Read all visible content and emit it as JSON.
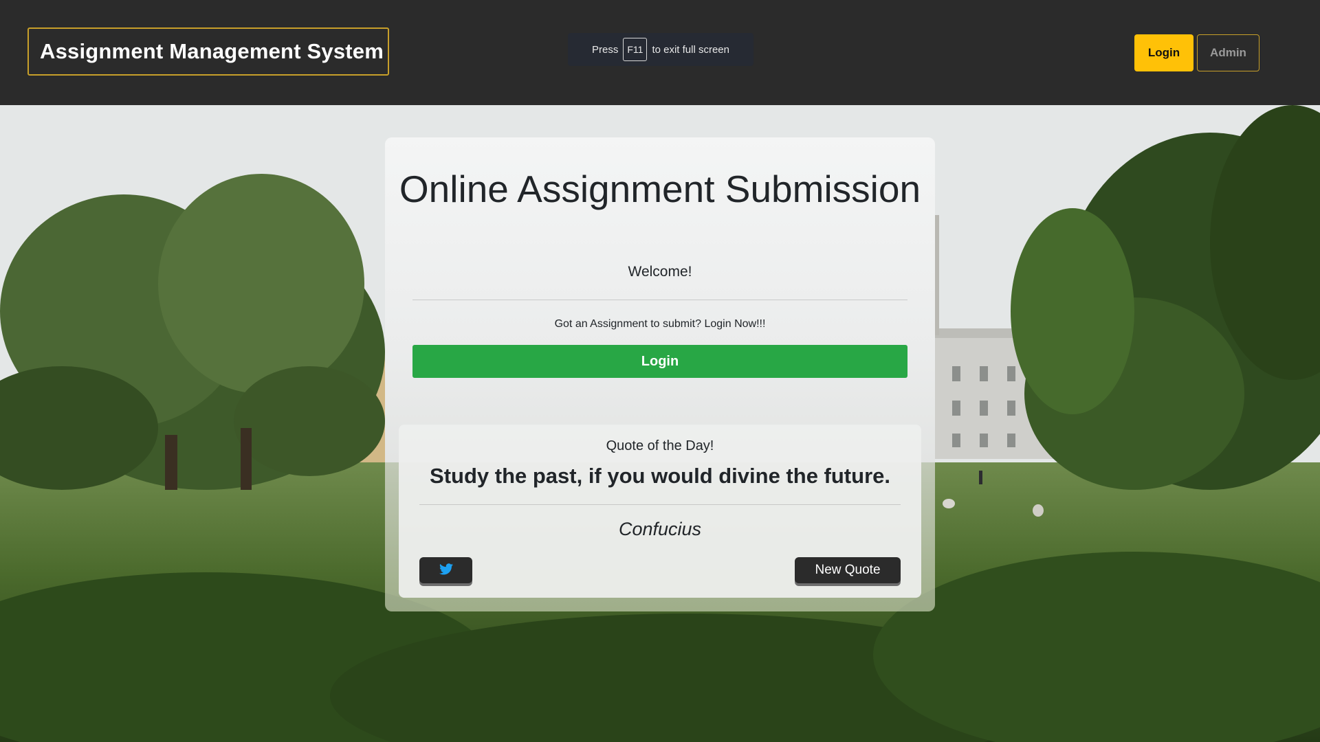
{
  "header": {
    "brand_title": "Assignment Management System",
    "login_label": "Login",
    "admin_label": "Admin"
  },
  "fullscreen_notice": {
    "press": "Press",
    "key": "F11",
    "suffix": "to exit full screen"
  },
  "main": {
    "title": "Online Assignment Submission",
    "welcome": "Welcome!",
    "prompt": "Got an Assignment to submit? Login Now!!!",
    "login_label": "Login"
  },
  "quote": {
    "heading": "Quote of the Day!",
    "text": "Study the past, if you would divine the future.",
    "author": "Confucius",
    "tweet_icon": "twitter-icon",
    "new_quote_label": "New Quote"
  },
  "colors": {
    "header_bg": "#2b2b2b",
    "accent_yellow": "#ffc107",
    "brand_border": "#c8a02a",
    "login_green": "#28a745",
    "twitter_blue": "#1da1f2"
  }
}
